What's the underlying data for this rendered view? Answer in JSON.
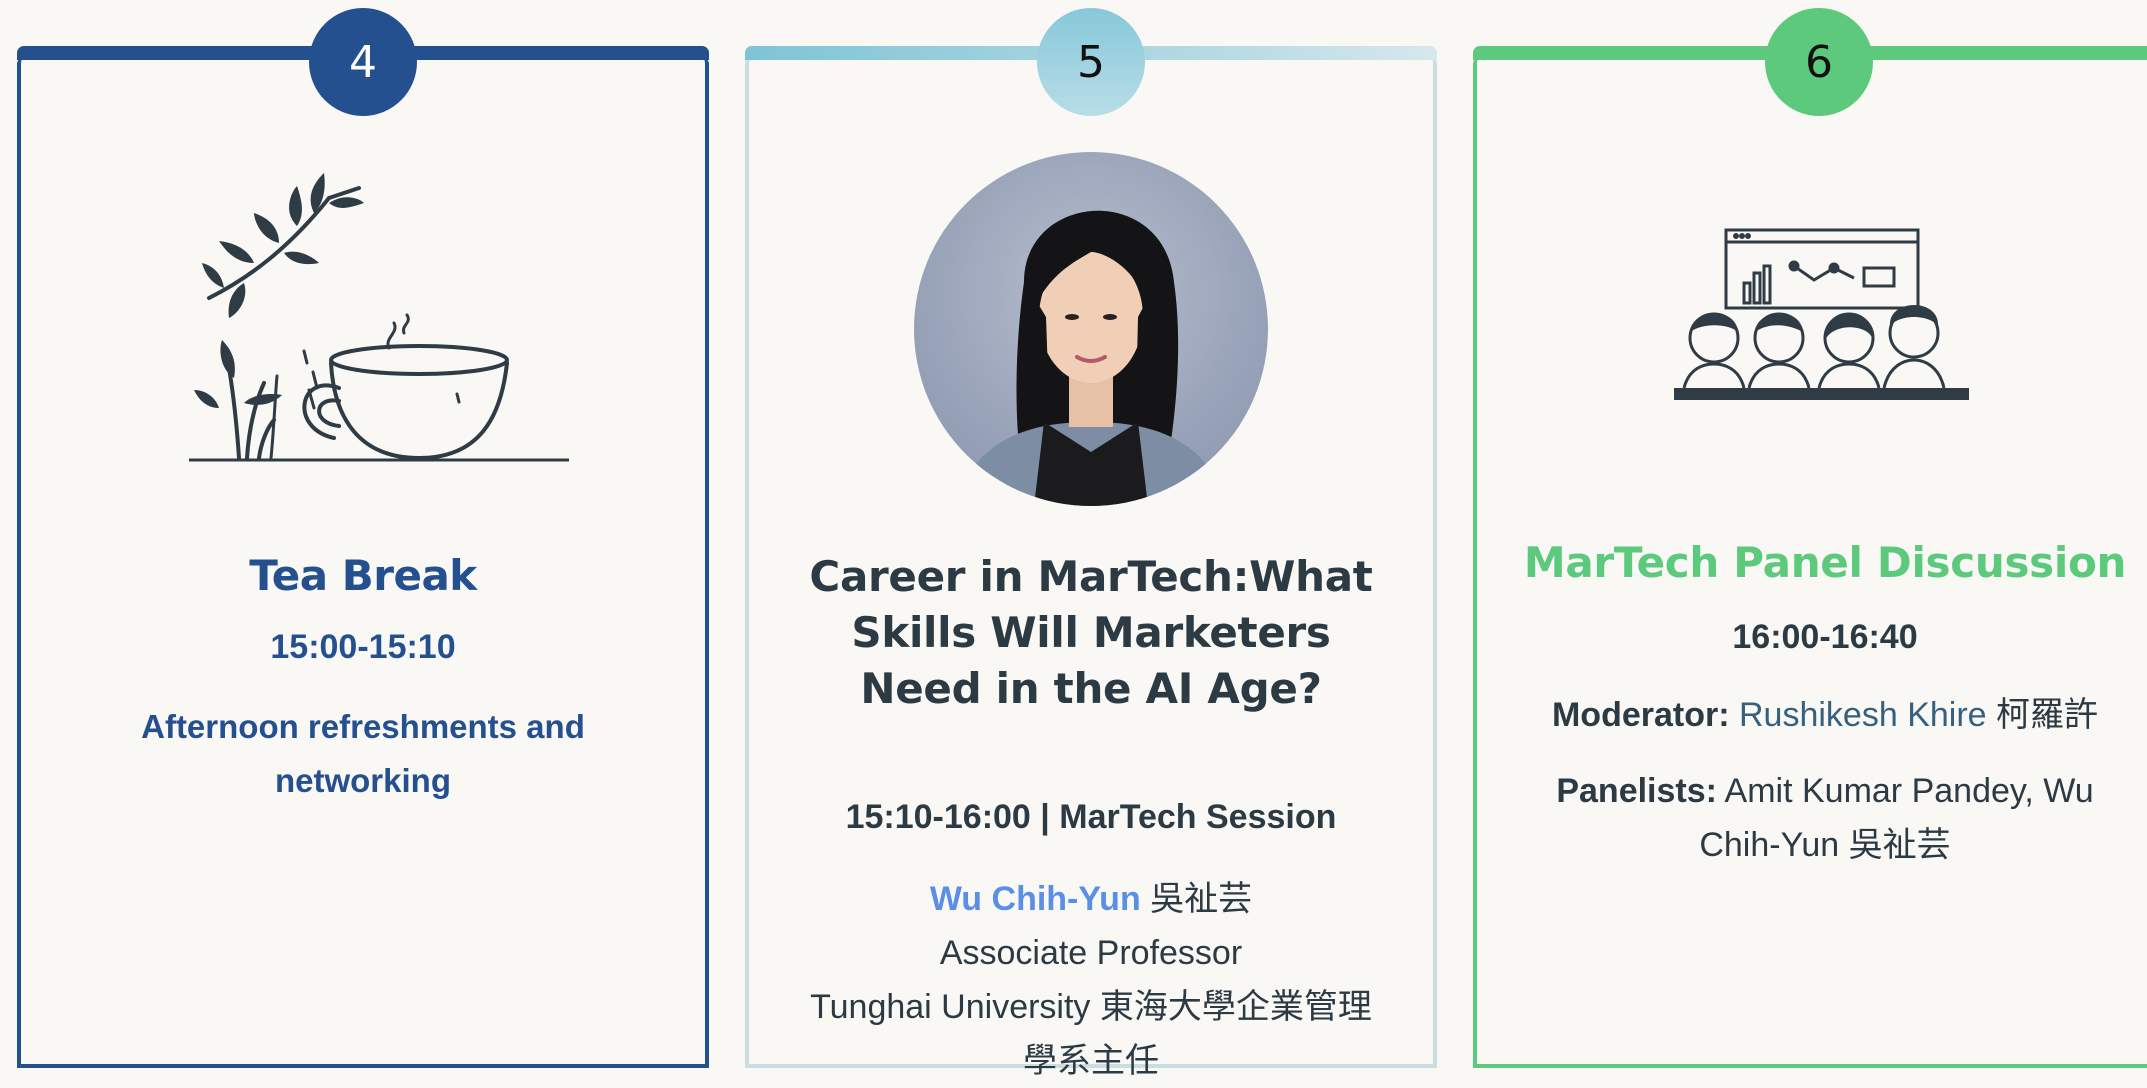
{
  "cards": [
    {
      "number": "4",
      "title": "Tea Break",
      "time": "15:00-15:10",
      "description": "Afternoon refreshments and networking",
      "illustration_icon": "teacup-icon"
    },
    {
      "number": "5",
      "title": "Career in MarTech:What Skills Will Marketers Need in the AI Age?",
      "time": "15:10-16:00",
      "time_separator": " | ",
      "session": "MarTech Session",
      "speaker_name": "Wu Chih-Yun",
      "speaker_name_zh": " 吳祉芸",
      "speaker_role": "Associate Professor",
      "speaker_affiliation": "Tunghai University 東海大學企業管理學系主任"
    },
    {
      "number": "6",
      "title": "MarTech Panel Discussion",
      "time": "16:00-16:40",
      "moderator_label": "Moderator:",
      "moderator_name": "Rushikesh Khire",
      "moderator_name_zh": " 柯羅許",
      "panelists_label": "Panelists:",
      "panelists": " Amit Kumar Pandey, Wu Chih-Yun 吳祉芸",
      "illustration_icon": "panel-discussion-icon"
    }
  ],
  "colors": {
    "card1_accent": "#24508f",
    "card2_accent": "#7ec4d6",
    "card3_accent": "#5cc97c",
    "speaker_name": "#5b8fe6",
    "text": "#2c3a44"
  }
}
